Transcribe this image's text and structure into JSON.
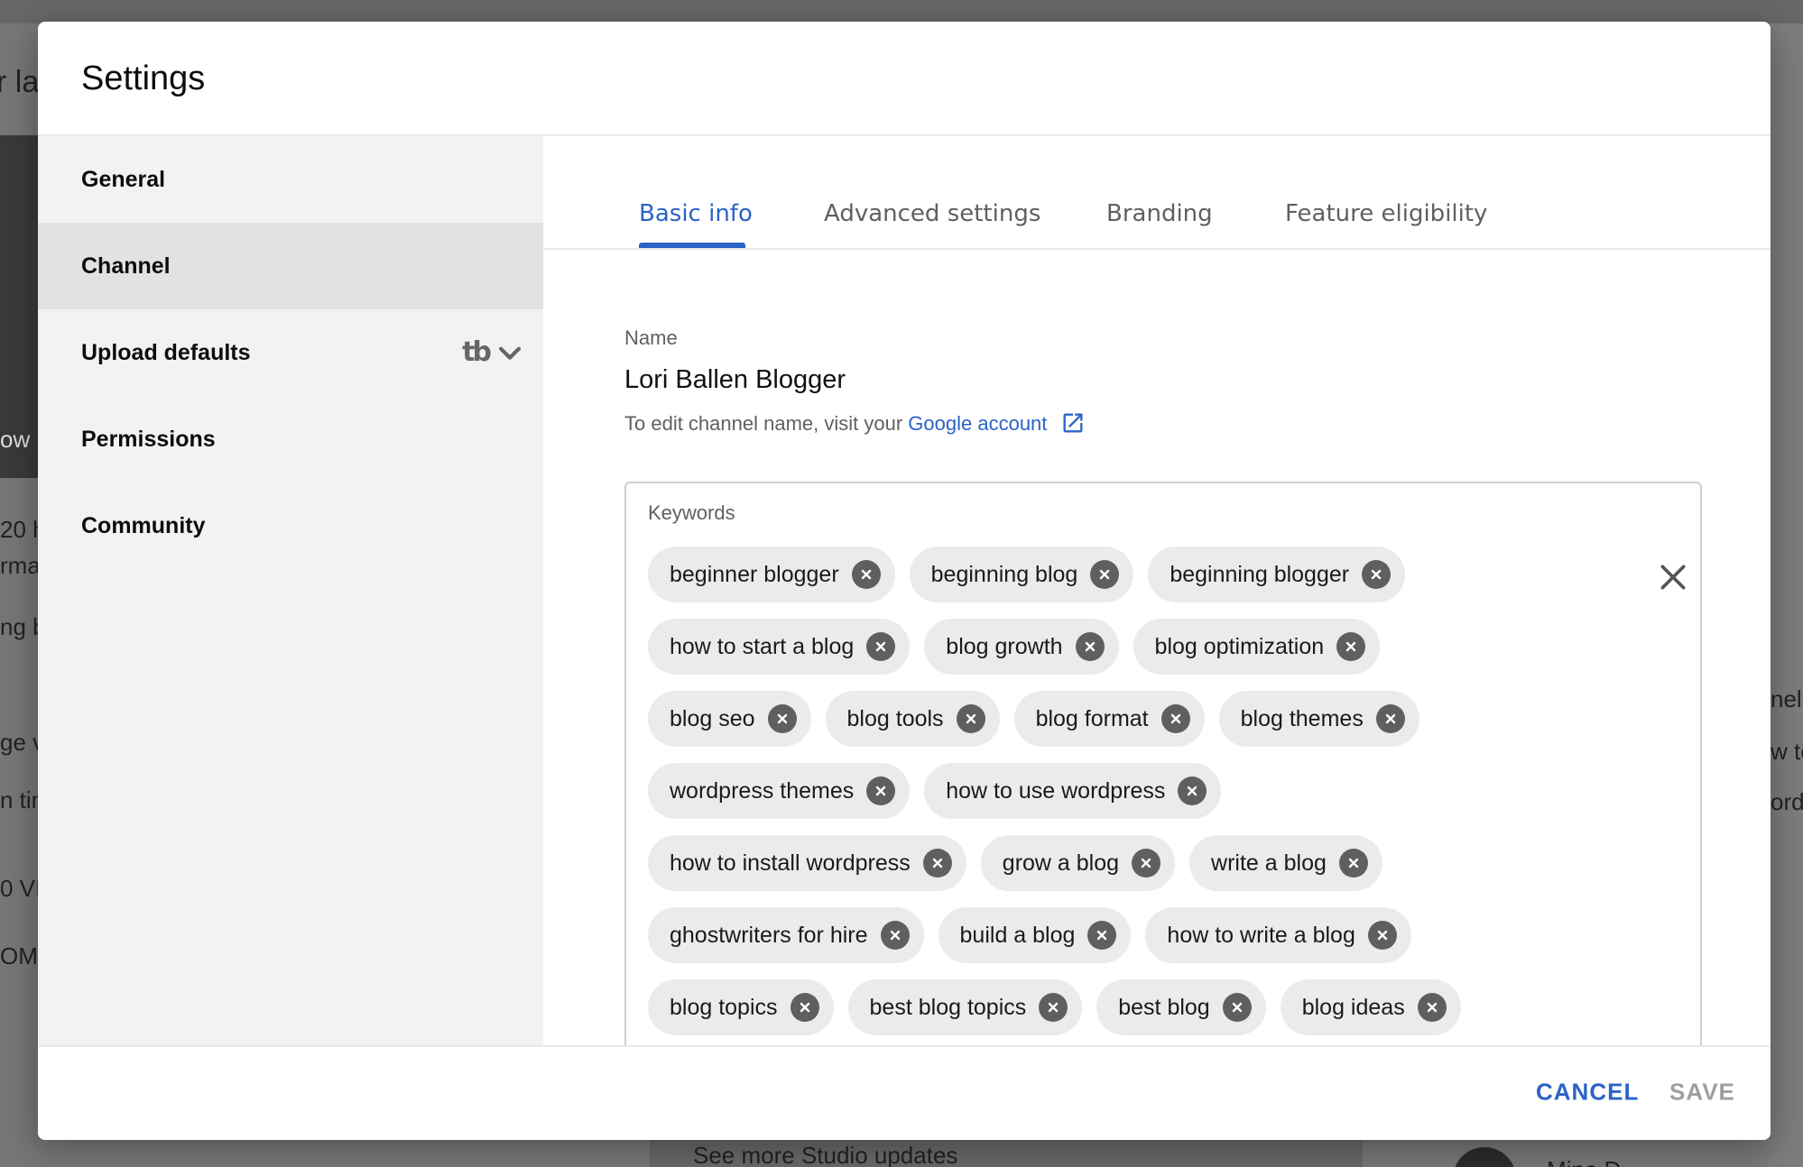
{
  "dialog": {
    "title": "Settings"
  },
  "background": {
    "snippets": [
      "r la",
      "ow",
      "20 h",
      "rma",
      "ng b",
      "ge v",
      "n tim",
      "0 VI",
      "OM",
      "nel",
      "w to",
      "ordl",
      "See more Studio updates",
      "Mina D"
    ]
  },
  "sidebar": {
    "items": [
      {
        "label": "General"
      },
      {
        "label": "Channel",
        "active": true
      },
      {
        "label": "Upload defaults",
        "extension": "tb"
      },
      {
        "label": "Permissions"
      },
      {
        "label": "Community"
      }
    ]
  },
  "tabs": [
    {
      "label": "Basic info",
      "active": true
    },
    {
      "label": "Advanced settings"
    },
    {
      "label": "Branding"
    },
    {
      "label": "Feature eligibility"
    }
  ],
  "basic_info": {
    "name_label": "Name",
    "channel_name": "Lori Ballen Blogger",
    "edit_hint_prefix": "To edit channel name, visit your",
    "edit_hint_link": "Google account",
    "keywords_label": "Keywords",
    "keyword_rows": [
      [
        "beginner blogger",
        "beginning blog",
        "beginning blogger"
      ],
      [
        "how to start a blog",
        "blog growth",
        "blog optimization"
      ],
      [
        "blog seo",
        "blog tools",
        "blog format",
        "blog themes"
      ],
      [
        "wordpress themes",
        "how to use wordpress"
      ],
      [
        "how to install wordpress",
        "grow a blog",
        "write a blog"
      ],
      [
        "ghostwriters for hire",
        "build a blog",
        "how to write a blog"
      ],
      [
        "blog topics",
        "best blog topics",
        "best blog",
        "blog ideas"
      ]
    ]
  },
  "footer": {
    "cancel_label": "CANCEL",
    "save_label": "SAVE"
  },
  "colors": {
    "accent": "#2b63c7",
    "chip_bg": "#ebebeb",
    "disabled": "#9e9e9e"
  }
}
